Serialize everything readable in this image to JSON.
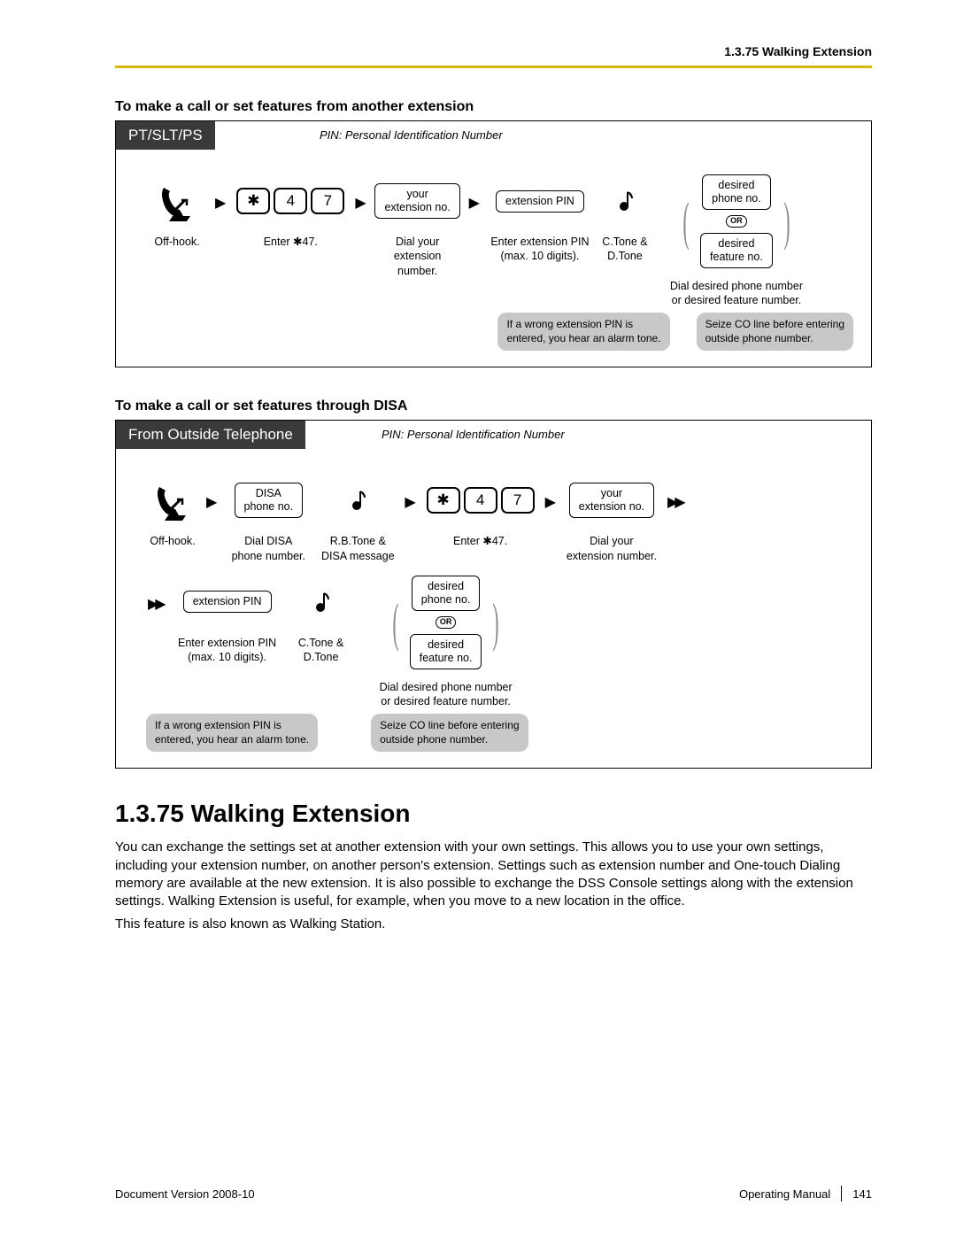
{
  "header": {
    "breadcrumb": "1.3.75 Walking Extension"
  },
  "sub1": "To make a call or set features from another extension",
  "sub2": "To make a call or set features through DISA",
  "d1": {
    "badge": "PT/SLT/PS",
    "pin_note": "PIN: Personal Identification Number",
    "offhook": "Off-hook.",
    "keys": {
      "star": "✱",
      "k4": "4",
      "k7": "7"
    },
    "enter47": "Enter ✱47.",
    "your_ext_box": "your\nextension no.",
    "dial_your_ext": "Dial your\nextension number.",
    "ext_pin_box": "extension PIN",
    "enter_pin": "Enter extension PIN\n(max. 10 digits).",
    "ctone": "C.Tone &\nD.Tone",
    "desired_phone": "desired\nphone no.",
    "or": "OR",
    "desired_feature": "desired\nfeature no.",
    "dial_desired": "Dial desired phone number\nor desired feature number.",
    "bubble_wrong_pin": "If a wrong extension PIN is\nentered, you hear an alarm tone.",
    "bubble_seize": "Seize CO line before entering\noutside phone number."
  },
  "d2": {
    "badge": "From Outside Telephone",
    "pin_note": "PIN: Personal Identification Number",
    "offhook": "Off-hook.",
    "disa_box": "DISA\nphone no.",
    "dial_disa": "Dial DISA\nphone number.",
    "rbtone": "R.B.Tone &\nDISA message",
    "keys": {
      "star": "✱",
      "k4": "4",
      "k7": "7"
    },
    "enter47": "Enter ✱47.",
    "your_ext_box": "your\nextension no.",
    "dial_your_ext": "Dial your\nextension number.",
    "ext_pin_box": "extension PIN",
    "enter_pin": "Enter extension PIN\n(max. 10 digits).",
    "ctone": "C.Tone &\nD.Tone",
    "desired_phone": "desired\nphone no.",
    "or": "OR",
    "desired_feature": "desired\nfeature no.",
    "dial_desired": "Dial desired phone number\nor desired feature number.",
    "bubble_wrong_pin": "If a wrong extension PIN is\nentered, you hear an alarm tone.",
    "bubble_seize": "Seize CO line before entering\noutside phone number."
  },
  "section": {
    "title": "1.3.75  Walking Extension",
    "p1": "You can exchange the settings set at another extension with your own settings. This allows you to use your own settings, including your extension number, on another person's extension. Settings such as extension number and One-touch Dialing memory are available at the new extension. It is also possible to exchange the DSS Console settings along with the extension settings. Walking Extension is useful, for example, when you move to a new location in the office.",
    "p2": "This feature is also known as Walking Station."
  },
  "footer": {
    "left": "Document Version  2008-10",
    "manual": "Operating Manual",
    "page": "141"
  }
}
